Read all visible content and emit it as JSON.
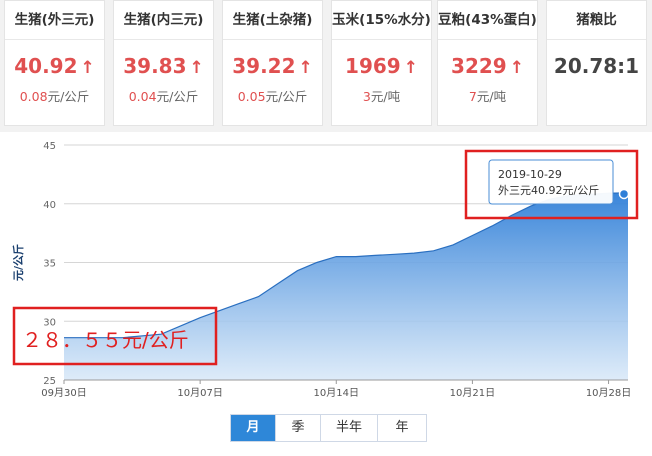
{
  "cards": [
    {
      "title": "生猪(外三元)",
      "value": "40.92",
      "change": "0.08",
      "unit": "元/公斤",
      "trend": "up"
    },
    {
      "title": "生猪(内三元)",
      "value": "39.83",
      "change": "0.04",
      "unit": "元/公斤",
      "trend": "up"
    },
    {
      "title": "生猪(土杂猪)",
      "value": "39.22",
      "change": "0.05",
      "unit": "元/公斤",
      "trend": "up"
    },
    {
      "title": "玉米(15%水分)",
      "value": "1969",
      "change": "3",
      "unit": "元/吨",
      "trend": "up"
    },
    {
      "title": "豆粕(43%蛋白)",
      "value": "3229",
      "change": "7",
      "unit": "元/吨",
      "trend": "up"
    },
    {
      "title": "猪粮比",
      "value": "20.78:1",
      "change": "",
      "unit": "",
      "trend": "none"
    }
  ],
  "trend_arrow": "↑",
  "colors": {
    "accent": "#2e87d8",
    "up": "#e05050",
    "annotation": "#e02020"
  },
  "chart_data": {
    "type": "area",
    "ylabel": "元/公斤",
    "ylim": [
      25,
      45
    ],
    "yticks": [
      "25",
      "30",
      "35",
      "40",
      "45"
    ],
    "x_tick_labels": [
      "09月30日",
      "10月07日",
      "10月14日",
      "10月21日",
      "10月28日"
    ],
    "x_tick_days": [
      0,
      7,
      14,
      21,
      28
    ],
    "x_range_days": [
      0,
      29
    ],
    "series": [
      {
        "name": "外三元",
        "x": [
          0,
          3,
          5,
          7,
          9,
          10,
          11,
          12,
          13,
          14,
          15,
          16,
          17,
          18,
          19,
          20,
          21,
          22,
          23,
          24,
          25,
          26,
          27,
          28,
          29
        ],
        "values": [
          28.6,
          28.6,
          28.9,
          30.3,
          31.5,
          32.1,
          33.2,
          34.3,
          35.0,
          35.5,
          35.5,
          35.6,
          35.7,
          35.8,
          36.0,
          36.5,
          37.3,
          38.1,
          39.0,
          39.8,
          40.4,
          40.7,
          40.8,
          40.9,
          40.92
        ]
      }
    ],
    "tooltip": {
      "date": "2019-10-29",
      "text": "外三元40.92元/公斤"
    },
    "annotation": "２８．５５元/公斤"
  },
  "range_tabs": [
    {
      "label": "月",
      "active": true
    },
    {
      "label": "季",
      "active": false
    },
    {
      "label": "半年",
      "active": false
    },
    {
      "label": "年",
      "active": false
    }
  ]
}
